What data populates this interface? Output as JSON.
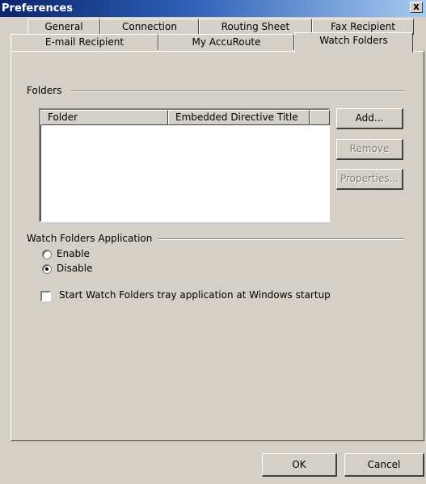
{
  "window": {
    "title": "Preferences",
    "close_glyph": "x"
  },
  "tabs": {
    "row1": [
      "General",
      "Connection",
      "Routing Sheet",
      "Fax Recipient"
    ],
    "row2": [
      "E-mail Recipient",
      "My AccuRoute",
      "Watch Folders"
    ],
    "active": "Watch Folders"
  },
  "folders": {
    "group_label": "Folders",
    "columns": [
      "Folder",
      "Embedded Directive Title"
    ],
    "rows": [],
    "buttons": {
      "add": "Add...",
      "remove": "Remove",
      "properties": "Properties..."
    },
    "disabled_buttons": [
      "Remove",
      "Properties..."
    ]
  },
  "watch_app": {
    "group_label": "Watch Folders Application",
    "options": [
      "Enable",
      "Disable"
    ],
    "selected": "Disable",
    "startup_checkbox": {
      "label": "Start Watch Folders tray application at Windows startup",
      "checked": false
    }
  },
  "footer": {
    "ok": "OK",
    "cancel": "Cancel"
  },
  "colors": {
    "titlebar_start": "#0a246a",
    "titlebar_end": "#a6caf0",
    "face": "#d4d0c8",
    "disabled_text": "#808080"
  },
  "icons": {
    "close": "close-icon"
  }
}
